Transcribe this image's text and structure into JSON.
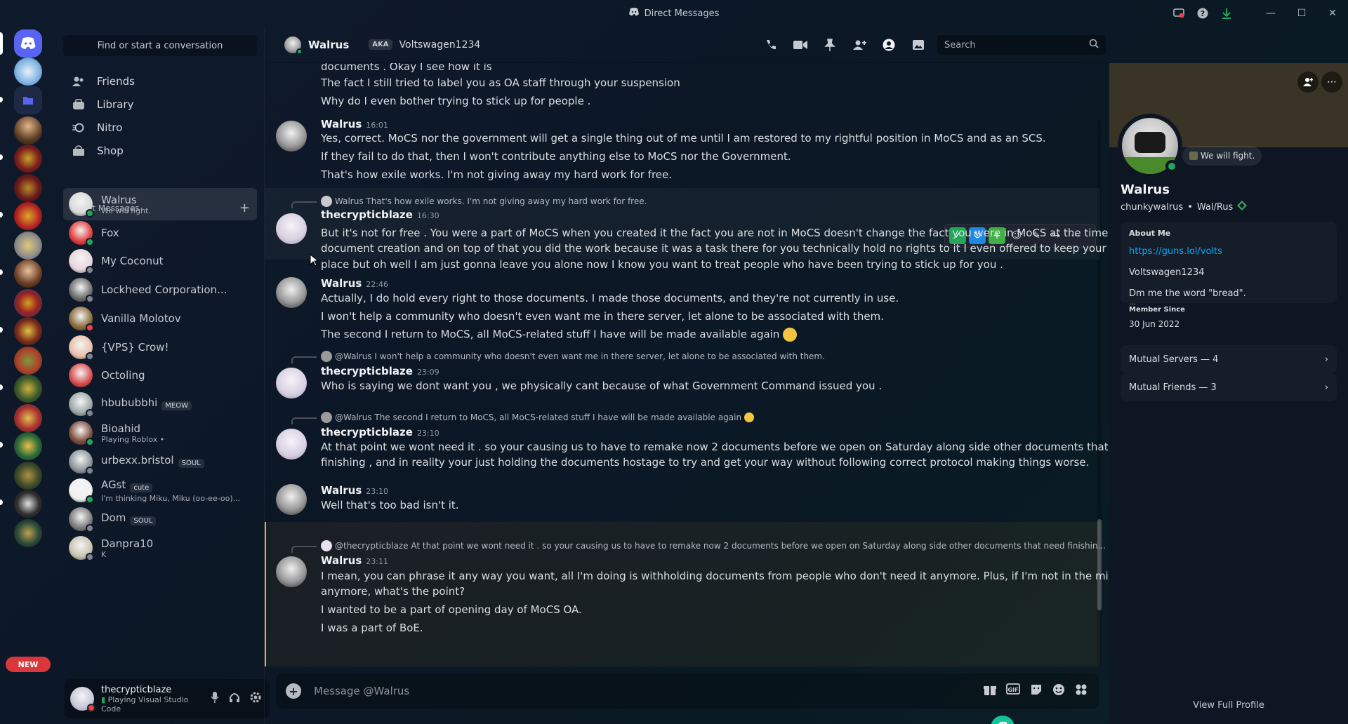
{
  "window": {
    "title": "Direct Messages"
  },
  "sidebar": {
    "search_label": "Find or start a conversation",
    "nav": [
      {
        "label": "Friends",
        "icon": "friends-icon"
      },
      {
        "label": "Library",
        "icon": "library-icon"
      },
      {
        "label": "Nitro",
        "icon": "nitro-icon"
      },
      {
        "label": "Shop",
        "icon": "shop-icon"
      }
    ],
    "dm_header": "Direct Messages",
    "dms": [
      {
        "name": "Walrus",
        "sub": "We will fight.",
        "tag": "",
        "active": true,
        "color": "#d8d8d8",
        "status": "#23a55a"
      },
      {
        "name": "Fox",
        "sub": "",
        "tag": "",
        "color": "#e23b3b",
        "status": "#23a55a"
      },
      {
        "name": "My Coconut",
        "sub": "",
        "tag": "",
        "color": "#e8d6dd",
        "status": "#80848e"
      },
      {
        "name": "Lockheed Corporation...",
        "sub": "",
        "tag": "",
        "color": "#6b6b6b",
        "status": "#80848e"
      },
      {
        "name": "Vanilla Molotov",
        "sub": "",
        "tag": "",
        "color": "#8a6a3a",
        "status": "#f23f43"
      },
      {
        "name": "{VPS} Crow!",
        "sub": "",
        "tag": "",
        "color": "#e9c0a8",
        "status": "#80848e"
      },
      {
        "name": "Octoling",
        "sub": "",
        "tag": "",
        "color": "#d94a4a",
        "status": ""
      },
      {
        "name": "hbububbhi",
        "sub": "",
        "tag": "MEOW",
        "color": "#9ba7a8",
        "status": "#80848e"
      },
      {
        "name": "Bioahid",
        "sub": "Playing Roblox •",
        "tag": "",
        "color": "#7d4b3a",
        "status": "#23a55a"
      },
      {
        "name": "urbexx.bristol",
        "sub": "",
        "tag": "SOUL",
        "color": "#8a949a",
        "status": "#80848e"
      },
      {
        "name": "AGst",
        "sub": "I'm thinking Miku, Miku (oo-ee-oo)...",
        "tag": "cute",
        "color": "#f0f0f0",
        "status": "#23a55a"
      },
      {
        "name": "Dom",
        "sub": "",
        "tag": "SOUL",
        "color": "#7a7a7a",
        "status": "#80848e"
      },
      {
        "name": "Danpra10",
        "sub": "K",
        "tag": "",
        "color": "#c8c2b0",
        "status": "#80848e"
      }
    ],
    "user": {
      "name": "thecrypticblaze",
      "status": "Playing Visual Studio Code"
    },
    "new_badge": "NEW"
  },
  "chat": {
    "name": "Walrus",
    "aka_label": "AKA",
    "alias": "Voltswagen1234",
    "search_placeholder": "Search",
    "composer_placeholder": "Message @Walrus",
    "lines": {
      "l1": "documents . Okay I see how it is",
      "l2": "The fact I still tried to label you as OA staff through your suspension",
      "l3": "Why do I even bother trying to stick up for people .",
      "w1_name": "Walrus",
      "w1_time": "16:01",
      "w1_l1": "Yes, correct. MoCS nor the government will get a single thing out of me until I am restored to my rightful position in MoCS and as an SCS.",
      "w1_l2": "If they fail to do that, then I won't contribute anything else to MoCS nor the Government.",
      "w1_l3": "That's how exile works. I'm not giving away my hard work for free.",
      "r1_reply": "Walrus That's how exile works. I'm not giving away my hard work for free.",
      "r1_name": "thecrypticblaze",
      "r1_time": "16:30",
      "r1_l1": "But it's not for free . You were a part of MoCS when you created it the fact you are not in MoCS doesn't change the fact you were in MoCS at the time of",
      "r1_l2": "document creation and on top of that you did the work because it was a task there for you technically hold no rights to it I even offered to keep your credit in",
      "r1_l3": "place but oh well I am just gonna leave you alone now I know you want to treat people who have been trying to stick up for you .",
      "w2_name": "Walrus",
      "w2_time": "22:46",
      "w2_l1": "Actually, I do hold every right to those documents. I made those documents, and they're not currently in use.",
      "w2_l2": "I won't help a community who doesn't even want me in there server, let alone to be associated with them.",
      "w2_l3": "The second I return to MoCS, all MoCS-related stuff I have will be made available again",
      "r2_reply": "@Walrus I won't help a community who doesn't even want me in there server, let alone to be associated with them.",
      "r2_name": "thecrypticblaze",
      "r2_time": "23:09",
      "r2_l1": "Who is saying we dont want you , we physically cant because of what Government Command issued you .",
      "r3_reply": "@Walrus The second I return to MoCS, all MoCS-related stuff I have will be made available again",
      "r3_name": "thecrypticblaze",
      "r3_time": "23:10",
      "r3_l1": "At that point we wont need it . so your causing us to have to remake now 2 documents before we open on Saturday along side other documents that need",
      "r3_l2": "finishing , and in reality your just holding the documents hostage to try and get your way without following correct protocol making things worse.",
      "w3_name": "Walrus",
      "w3_time": "23:10",
      "w3_l1": "Well that's too bad isn't it.",
      "w4_reply": "@thecrypticblaze At that point we wont need it . so your causing us to have to remake now 2 documents before we open on Saturday along side other documents that need finishin...",
      "w4_name": "Walrus",
      "w4_time": "23:11",
      "w4_l1": "I mean, you can phrase it any way you want, all I'm doing is withholding documents from people who don't need it anymore. Plus, if I'm not in the ministry",
      "w4_l2": "anymore, what's the point?",
      "w4_l3": "I wanted to be a part of opening day of MoCS OA.",
      "w4_l4": "I was a part of BoE."
    }
  },
  "profile": {
    "custom_status": "We will fight.",
    "display_name": "Walrus",
    "username": "chunkywalrus",
    "pronouns": "Wal/Rus",
    "about_label": "About Me",
    "about_link": "https://guns.lol/volts",
    "about_alias": "Voltswagen1234",
    "about_text": "Dm me the word \"bread\".",
    "about_more": "...",
    "member_since_label": "Member Since",
    "member_since": "30 Jun 2022",
    "mutual_servers": "Mutual Servers — 4",
    "mutual_friends": "Mutual Friends — 3",
    "view_full": "View Full Profile"
  },
  "colors": {
    "accent": "#5865f2",
    "online": "#23a55a",
    "dnd": "#f23f43",
    "link": "#00a8fc"
  }
}
